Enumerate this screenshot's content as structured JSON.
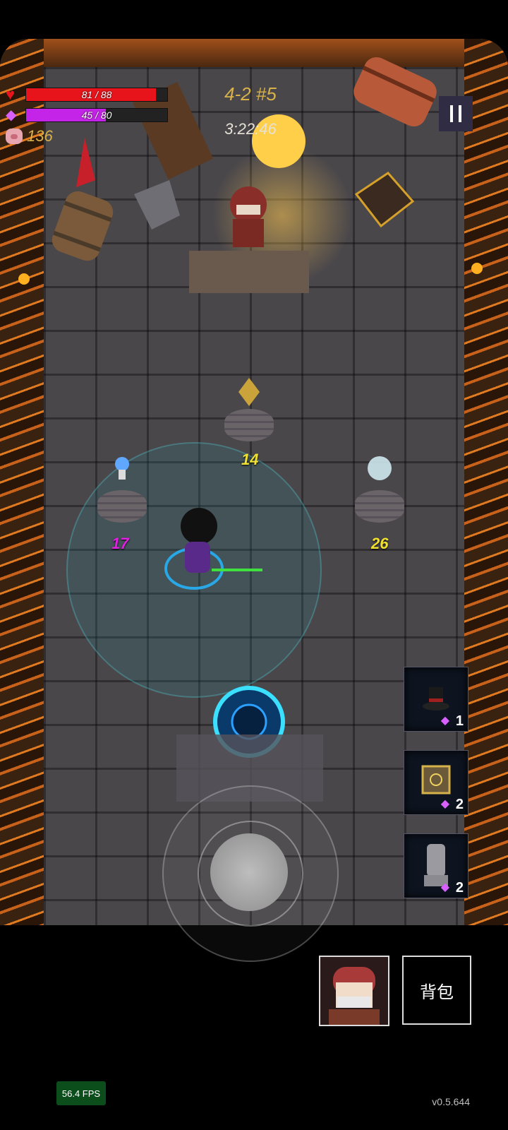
{
  "hud": {
    "hp": {
      "current": 81,
      "max": 88,
      "text": "81 / 88",
      "color": "#e8141c"
    },
    "mp": {
      "current": 45,
      "max": 80,
      "text": "45 / 80",
      "color": "#c423e8"
    },
    "coins": "136",
    "level": "4-2 #5",
    "timer": "3:22:46"
  },
  "shop_items": [
    {
      "name": "golden-relic",
      "price": "14",
      "price_color": "#f0e030"
    },
    {
      "name": "blue-ring",
      "price": "17",
      "price_color": "#e020e0"
    },
    {
      "name": "crystal-orb",
      "price": "26",
      "price_color": "#f0e030"
    }
  ],
  "quick_items": [
    {
      "icon": "top-hat-icon",
      "count": "1"
    },
    {
      "icon": "golden-box-icon",
      "count": "2"
    },
    {
      "icon": "stone-head-icon",
      "count": "2"
    }
  ],
  "bag_label": "背包",
  "fps": "56.4 FPS",
  "version": "v0.5.644"
}
